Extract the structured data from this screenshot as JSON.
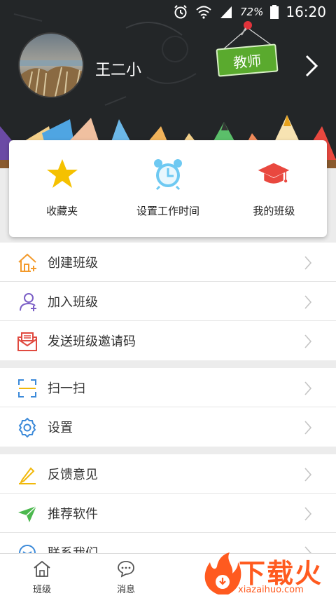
{
  "status_bar": {
    "battery": "72%",
    "time": "16:20"
  },
  "profile": {
    "username": "王二小",
    "role": "教师"
  },
  "quick_actions": [
    {
      "label": "收藏夹",
      "icon": "star-icon"
    },
    {
      "label": "设置工作时间",
      "icon": "alarm-clock-icon"
    },
    {
      "label": "我的班级",
      "icon": "graduation-cap-icon"
    }
  ],
  "menu_group_1": [
    {
      "label": "创建班级",
      "icon": "home-plus-icon"
    },
    {
      "label": "加入班级",
      "icon": "add-user-icon"
    },
    {
      "label": "发送班级邀请码",
      "icon": "envelope-icon"
    }
  ],
  "menu_group_2": [
    {
      "label": "扫一扫",
      "icon": "scan-icon"
    },
    {
      "label": "设置",
      "icon": "gear-icon"
    }
  ],
  "menu_group_3": [
    {
      "label": "反馈意见",
      "icon": "pencil-icon"
    },
    {
      "label": "推荐软件",
      "icon": "paper-plane-icon"
    },
    {
      "label": "联系我们",
      "icon": "contact-icon"
    }
  ],
  "bottom_nav": [
    {
      "label": "班级",
      "icon": "class-home-icon"
    },
    {
      "label": "消息",
      "icon": "message-bubble-icon"
    }
  ],
  "watermark": {
    "text": "下载火",
    "site": "xiazaihuo.com"
  },
  "colors": {
    "header_bg": "#232628",
    "role_badge": "#5aaa2e",
    "star": "#f5c100",
    "clock": "#6ec9f2",
    "cap": "#e9483f",
    "accent_orange": "#f39a2b",
    "accent_purple": "#7b5fc6",
    "accent_red": "#e04a40",
    "accent_blue": "#3c8ad9",
    "accent_yellow": "#f1b80a",
    "accent_green": "#4cb84e",
    "watermark": "#ff5a1f"
  }
}
